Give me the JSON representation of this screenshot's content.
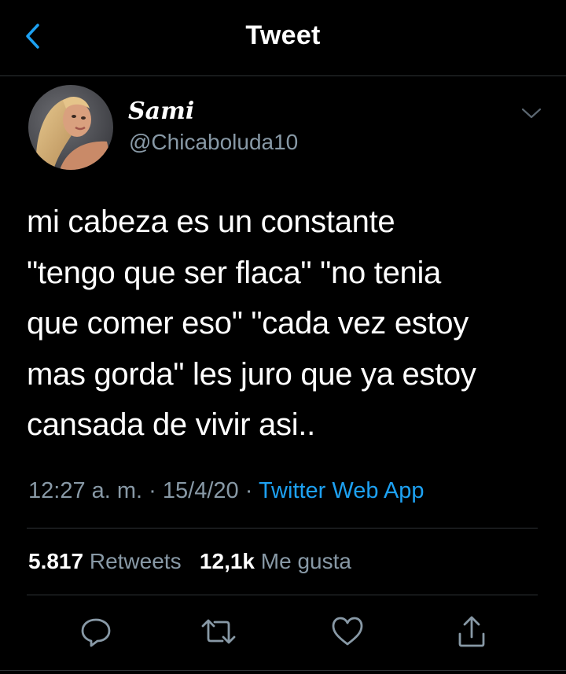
{
  "header": {
    "title": "Tweet",
    "back_icon": "chevron-left-icon"
  },
  "author": {
    "display_name": "Sami",
    "handle": "@Chicaboluda10",
    "avatar": "avatar-photo"
  },
  "tweet": {
    "lines": [
      "mi cabeza es un constante",
      "\"tengo que ser flaca\" \"no tenia",
      "que comer eso\" \"cada vez estoy",
      "mas gorda\" les juro que ya estoy",
      "cansada de vivir asi.."
    ],
    "time": "12:27 a. m.",
    "date": "15/4/20",
    "separator": "·",
    "source": "Twitter Web App"
  },
  "stats": {
    "retweets_count": "5.817",
    "retweets_label": "Retweets",
    "likes_count": "12,1k",
    "likes_label": "Me gusta"
  },
  "actions": [
    "reply-icon",
    "retweet-icon",
    "like-icon",
    "share-icon"
  ],
  "colors": {
    "background": "#000000",
    "accent": "#1da1f2",
    "muted": "#8899a6",
    "divider": "#2f3336"
  }
}
